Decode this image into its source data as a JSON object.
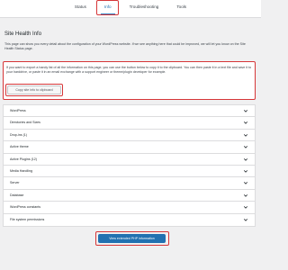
{
  "tabs": [
    {
      "label": "Status"
    },
    {
      "label": "Info"
    },
    {
      "label": "Troubleshooting"
    },
    {
      "label": "Tools"
    }
  ],
  "page": {
    "title": "Site Health Info",
    "intro": "This page can show you every detail about the configuration of your WordPress website. If we see anything here that could be improved, we will let you know on the Site Health Status page.",
    "copy_instructions": "If you want to export a handy list of all the information on this page, you can use the button below to copy it to the clipboard. You can then paste it in a text file and save it to your harddrive, or paste it in an email exchange with a support engineer or theme/plugin developer for example.",
    "copy_button_label": "Copy site info to clipboard"
  },
  "sections": [
    {
      "label": "WordPress"
    },
    {
      "label": "Directories and Sizes"
    },
    {
      "label": "Drop-ins (1)"
    },
    {
      "label": "Active theme"
    },
    {
      "label": "Active Plugins (12)"
    },
    {
      "label": "Media Handling"
    },
    {
      "label": "Server"
    },
    {
      "label": "Database"
    },
    {
      "label": "WordPress constants"
    },
    {
      "label": "File system permissions"
    }
  ],
  "footer": {
    "extended_button_label": "View extended PHP information"
  },
  "colors": {
    "accent": "#2271b1",
    "highlight": "#d63638"
  }
}
